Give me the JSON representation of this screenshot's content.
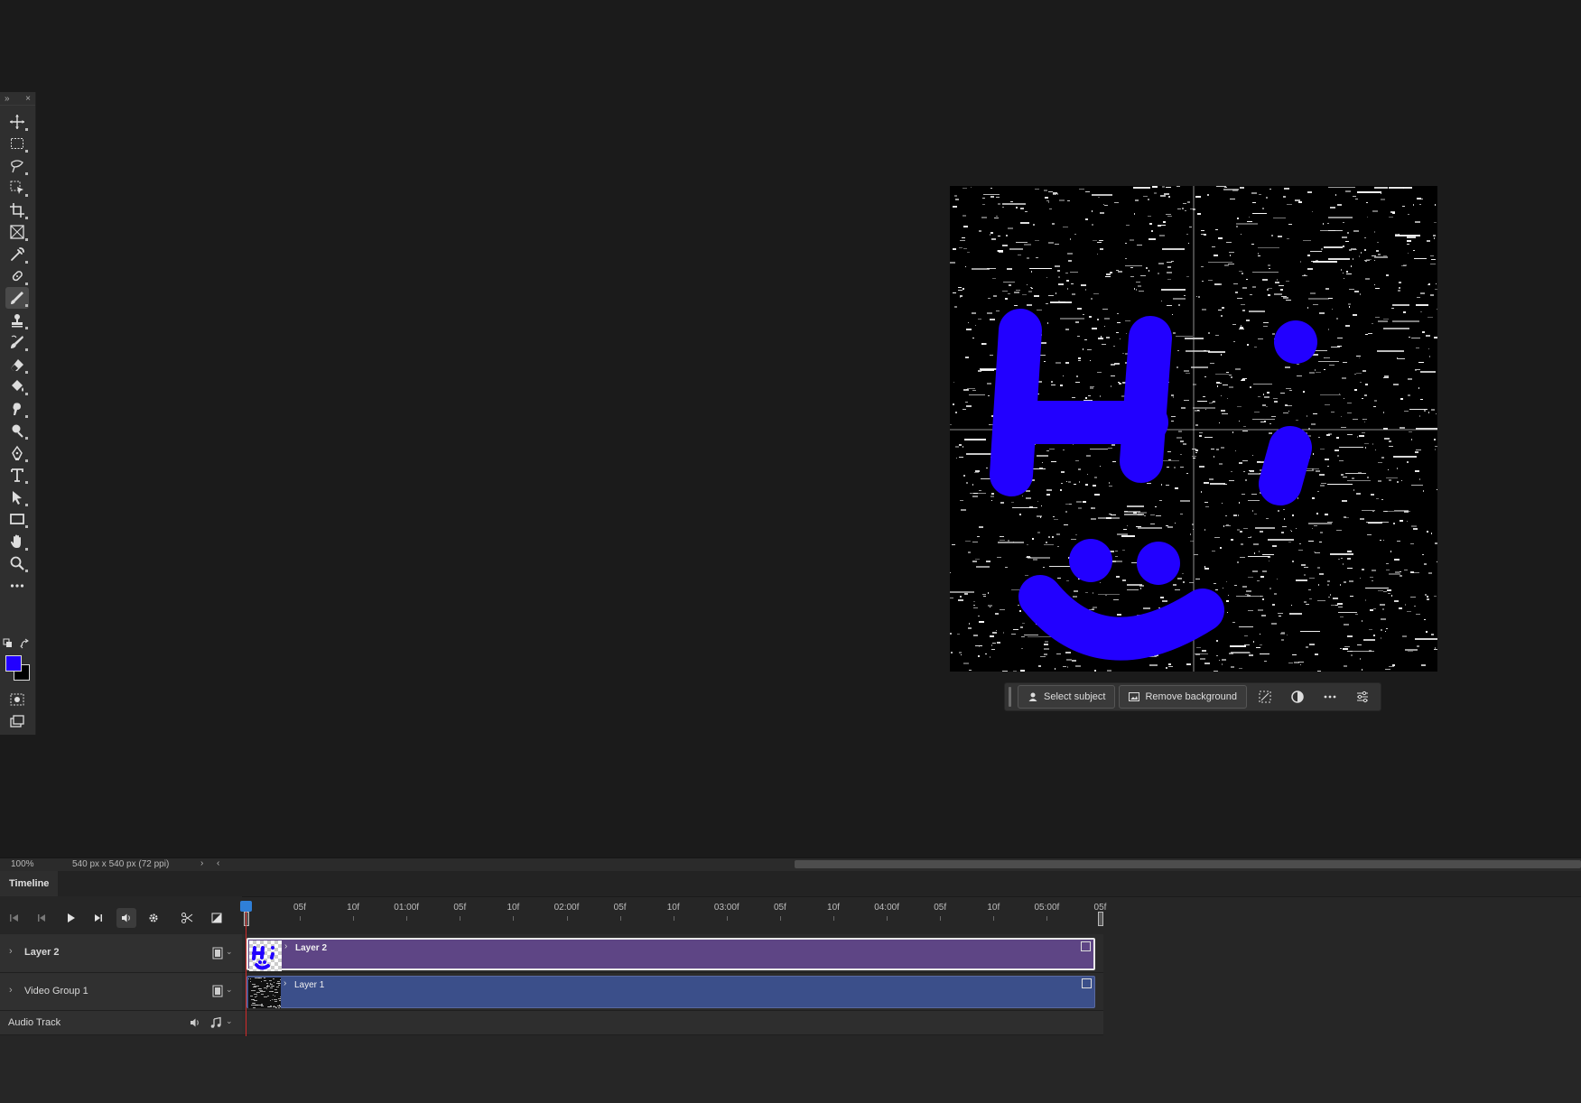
{
  "toolbar": {
    "tools": [
      {
        "icon": "move-icon",
        "active": false
      },
      {
        "icon": "rectangular-marquee-icon",
        "active": false
      },
      {
        "icon": "lasso-icon",
        "active": false
      },
      {
        "icon": "object-selection-icon",
        "active": false
      },
      {
        "icon": "crop-icon",
        "active": false
      },
      {
        "icon": "frame-icon",
        "active": false
      },
      {
        "icon": "eyedropper-icon",
        "active": false
      },
      {
        "icon": "spot-healing-icon",
        "active": false
      },
      {
        "icon": "brush-icon",
        "active": true
      },
      {
        "icon": "clone-stamp-icon",
        "active": false
      },
      {
        "icon": "history-brush-icon",
        "active": false
      },
      {
        "icon": "eraser-icon",
        "active": false
      },
      {
        "icon": "paint-bucket-icon",
        "active": false
      },
      {
        "icon": "smudge-icon",
        "active": false
      },
      {
        "icon": "dodge-icon",
        "active": false
      },
      {
        "icon": "pen-icon",
        "active": false
      },
      {
        "icon": "type-icon",
        "active": false
      },
      {
        "icon": "path-selection-icon",
        "active": false
      },
      {
        "icon": "rectangle-shape-icon",
        "active": false
      },
      {
        "icon": "hand-icon",
        "active": false
      },
      {
        "icon": "zoom-icon",
        "active": false
      },
      {
        "icon": "more-tools-icon",
        "active": false
      }
    ],
    "foreground_color": "#2200ff",
    "background_color": "#000000"
  },
  "contextual_taskbar": {
    "select_subject_label": "Select subject",
    "remove_background_label": "Remove background"
  },
  "statusbar": {
    "zoom": "100%",
    "doc_info": "540 px x 540 px (72 ppi)"
  },
  "timeline": {
    "tab_label": "Timeline",
    "ruler_labels": [
      "05f",
      "10f",
      "01:00f",
      "05f",
      "10f",
      "02:00f",
      "05f",
      "10f",
      "03:00f",
      "05f",
      "10f",
      "04:00f",
      "05f",
      "10f",
      "05:00f",
      "05f"
    ],
    "tracks": [
      {
        "header": "Layer 2",
        "clip": "Layer 2",
        "color": "#5e4585"
      },
      {
        "header": "Video Group 1",
        "clip": "Layer 1",
        "color": "#3b4f8a"
      }
    ],
    "audio_track_label": "Audio Track"
  },
  "colors": {
    "accent_blue": "#2200ff",
    "playhead": "#d12a2a"
  }
}
